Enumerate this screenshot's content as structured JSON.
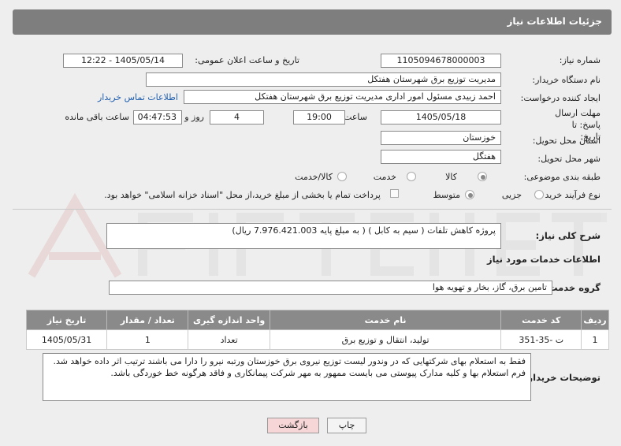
{
  "header": {
    "title": "جزئیات اطلاعات نیاز"
  },
  "form": {
    "need_number_label": "شماره نیاز:",
    "need_number": "1105094678000003",
    "announce_label": "تاریخ و ساعت اعلان عمومی:",
    "announce_value": "1405/05/14 - 12:22",
    "buyer_org_label": "نام دستگاه خریدار:",
    "buyer_org": "مدیریت توزیع برق شهرستان هفتکل",
    "creator_label": "ایجاد کننده درخواست:",
    "creator": "احمد زبیدی مسئول امور اداری مدیریت توزیع برق شهرستان هفتکل",
    "contact_link": "اطلاعات تماس خریدار",
    "deadline_label": "مهلت ارسال پاسخ: تا تاریخ:",
    "deadline_date": "1405/05/18",
    "time_label": "ساعت",
    "deadline_time": "19:00",
    "days_value": "4",
    "days_label": "روز و",
    "remaining_time": "04:47:53",
    "remaining_label": "ساعت باقی مانده",
    "province_label": "استان محل تحویل:",
    "province": "خوزستان",
    "city_label": "شهر محل تحویل:",
    "city": "هفتگل",
    "category_label": "طبقه بندی موضوعی:",
    "category_options": [
      "کالا",
      "خدمت",
      "کالا/خدمت"
    ],
    "process_label": "نوع فرآیند خرید :",
    "process_options": [
      "جزیی",
      "متوسط"
    ],
    "payment_note": "پرداخت تمام یا بخشی از مبلغ خرید،از محل \"اسناد خزانه اسلامی\" خواهد بود."
  },
  "summary": {
    "label": "شرح کلی نیاز:",
    "text": "پروژه کاهش تلفات ( سیم به کابل ) ( به مبلغ پایه 7.976.421.003 ریال)"
  },
  "services": {
    "section_title": "اطلاعات خدمات مورد نیاز",
    "group_label": "گروه خدمت:",
    "group_value": "تامین برق، گاز، بخار و تهویه هوا",
    "columns": [
      "ردیف",
      "کد خدمت",
      "نام خدمت",
      "واحد اندازه گیری",
      "تعداد / مقدار",
      "تاریخ نیاز"
    ],
    "rows": [
      {
        "idx": "1",
        "code": "ت -35-351",
        "name": "تولید، انتقال و توزیع برق",
        "unit": "تعداد",
        "qty": "1",
        "date": "1405/05/31"
      }
    ]
  },
  "notes": {
    "label": "توضیحات خریدار:",
    "line1": "فقط به استعلام بهای شرکتهایی که در وندور لیست توزیع نیروی برق خوزستان ورتبه نیرو را دارا می باشند ترتیب اثر داده خواهد شد.",
    "line2": "فرم استعلام بها و کلیه مدارک پیوستی می بایست ممهور به مهر شرکت پیمانکاری و فاقد هرگونه خط خوردگی باشد."
  },
  "buttons": {
    "print": "چاپ",
    "back": "بازگشت"
  },
  "colors": {
    "header_bg": "#7e7e7e",
    "link": "#1f5fb0",
    "back_button_bg": "#f6d6d6"
  }
}
